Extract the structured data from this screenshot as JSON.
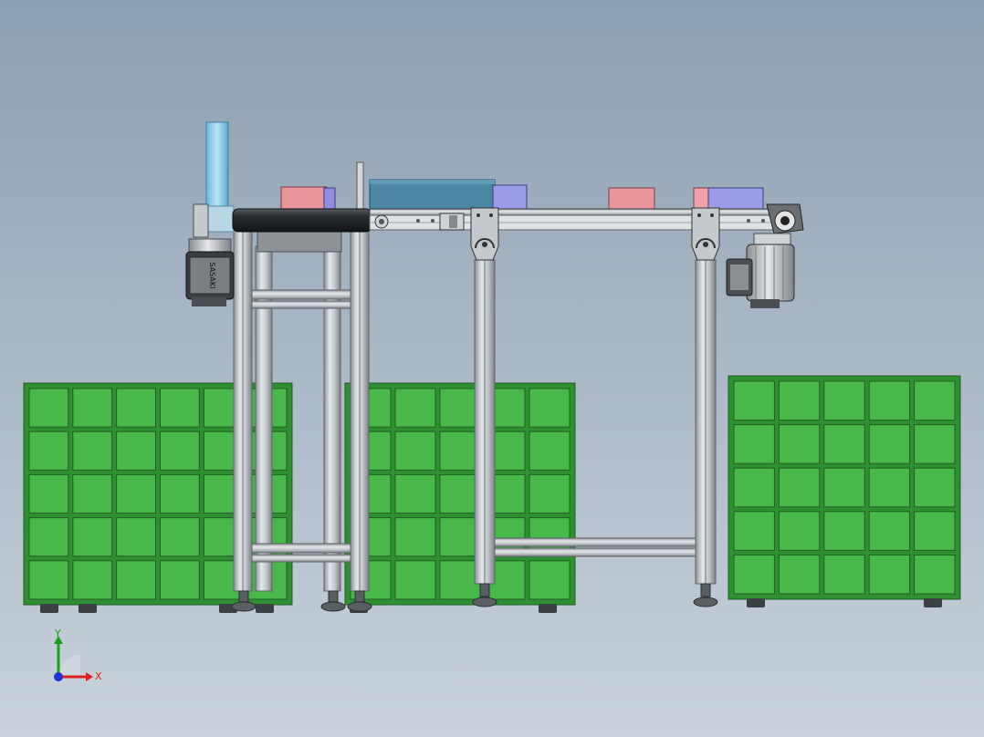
{
  "viewport": {
    "background_top": "#8d9fb2",
    "background_bottom": "#c9d2db"
  },
  "model": {
    "colors": {
      "crate_green": "#48b84a",
      "crate_edge": "#1f5f22",
      "aluminium": "#c8cdd2",
      "aluminium_dark": "#7c8288",
      "motor_body": "#c9ccd0",
      "motor_dark": "#2c2f33",
      "pink_box": "#e8959b",
      "purple_box": "#9c9be8",
      "blue_box": "#4b86a3",
      "cyan_cylinder": "#8fd0ef"
    },
    "motor_left_badge": "SASAKI",
    "crates": [
      {
        "rows": 5,
        "cols": 6
      },
      {
        "rows": 5,
        "cols": 5
      },
      {
        "rows": 5,
        "cols": 5
      }
    ]
  },
  "triad": {
    "x_label": "X",
    "y_label": "Y",
    "x_color": "#e02020",
    "y_color": "#18a018",
    "z_color": "#1f32d0"
  }
}
